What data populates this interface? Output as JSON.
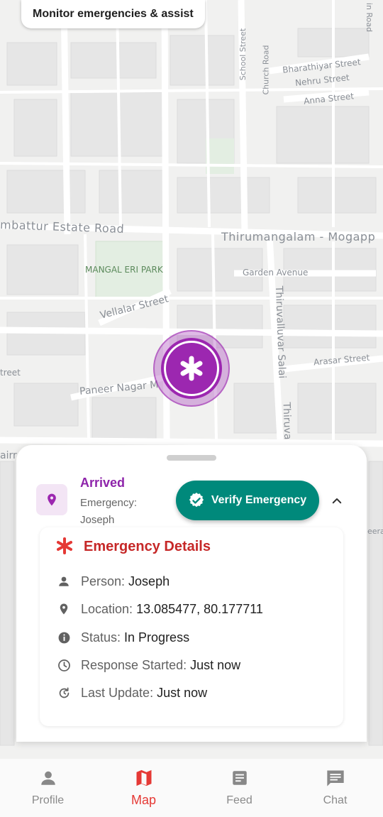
{
  "header": {
    "chip_text": "Monitor emergencies & assist"
  },
  "map": {
    "labels": {
      "bharathiyar": "Bharathiyar Street",
      "nehru": "Nehru Street",
      "anna": "Anna Street",
      "school": "School Street",
      "church": "Church Road",
      "road_edge": "in Road",
      "estate": "mbattur Estate Road",
      "thirumangalam": "Thirumangalam - Mogapp",
      "park": "MANGAL ERI PARK",
      "garden": "Garden Avenue",
      "vellalar": "Vellalar Street",
      "thiruvalluvar": "Thiruvalluvar Salai",
      "arasar": "Arasar Street",
      "paneer": "Paneer Nagar M",
      "street_left": "treet",
      "thiruva": "Thiruva",
      "airr": "airr",
      "eera": "eera"
    }
  },
  "marker": {
    "icon": "medical-asterisk-icon",
    "color": "#9c27b0"
  },
  "sheet": {
    "status_title": "Arrived",
    "status_subtitle": "Emergency: Joseph",
    "verify_button": "Verify Emergency",
    "details": {
      "title": "Emergency Details",
      "rows": [
        {
          "icon": "person-icon",
          "label": "Person:",
          "value": "Joseph"
        },
        {
          "icon": "location-pin-icon",
          "label": "Location:",
          "value": "13.085477, 80.177711"
        },
        {
          "icon": "info-icon",
          "label": "Status:",
          "value": "In Progress"
        },
        {
          "icon": "clock-icon",
          "label": "Response Started:",
          "value": "Just now"
        },
        {
          "icon": "history-icon",
          "label": "Last Update:",
          "value": "Just now"
        }
      ]
    }
  },
  "nav": {
    "items": [
      {
        "label": "Profile",
        "icon": "person-icon"
      },
      {
        "label": "Map",
        "icon": "map-icon"
      },
      {
        "label": "Feed",
        "icon": "article-icon"
      },
      {
        "label": "Chat",
        "icon": "chat-icon"
      }
    ],
    "active": "Map"
  },
  "colors": {
    "accent": "#9c27b0",
    "primary_button": "#00897b",
    "danger": "#c62828",
    "active_nav": "#e53935"
  }
}
